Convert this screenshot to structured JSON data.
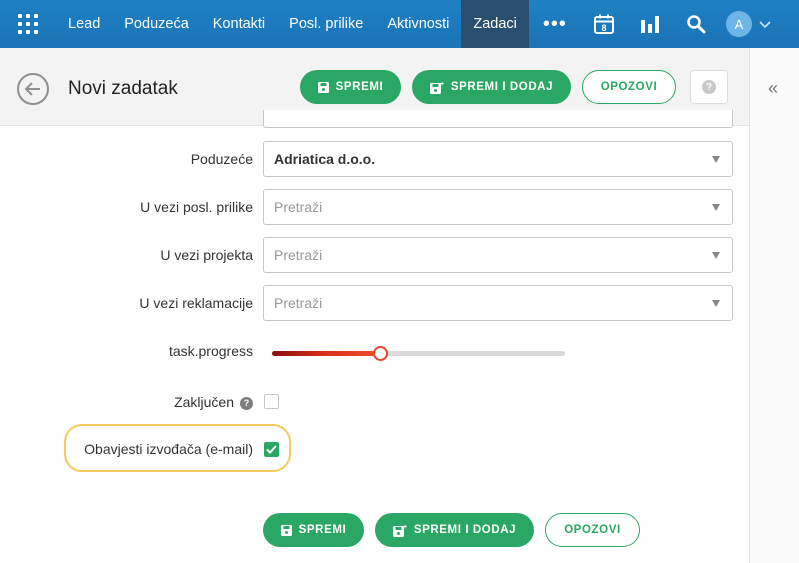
{
  "nav": {
    "items": [
      "Lead",
      "Poduzeća",
      "Kontakti",
      "Posl. prilike",
      "Aktivnosti",
      "Zadaci"
    ],
    "active": "Zadaci",
    "more": "•••",
    "calendar_day": "8",
    "avatar_initial": "A"
  },
  "header": {
    "title": "Novi zadatak",
    "save_label": "SPREMI",
    "save_add_label": "SPREMI I DODAJ",
    "cancel_label": "OPOZOVI",
    "help": "?"
  },
  "side_panel": {
    "collapse": "«"
  },
  "form": {
    "company": {
      "label": "Poduzeće",
      "value": "Adriatica d.o.o."
    },
    "opportunity": {
      "label": "U vezi posl. prilike",
      "placeholder": "Pretraži"
    },
    "project": {
      "label": "U vezi projekta",
      "placeholder": "Pretraži"
    },
    "complaint": {
      "label": "U vezi reklamacije",
      "placeholder": "Pretraži"
    },
    "progress": {
      "label": "task.progress",
      "value_percent": 37
    },
    "completed": {
      "label": "Zaključen",
      "help": "?",
      "checked": false
    },
    "notify": {
      "label": "Obavjesti izvođača (e-mail)",
      "checked": true
    }
  },
  "footer": {
    "save_label": "SPREMI",
    "save_add_label": "SPREMI I DODAJ",
    "cancel_label": "OPOZOVI"
  },
  "colors": {
    "nav": "#1e80c4",
    "nav_active": "#2a4f6e",
    "primary": "#2aa764",
    "highlight": "#f7c95d",
    "slider": "#e8472a"
  }
}
